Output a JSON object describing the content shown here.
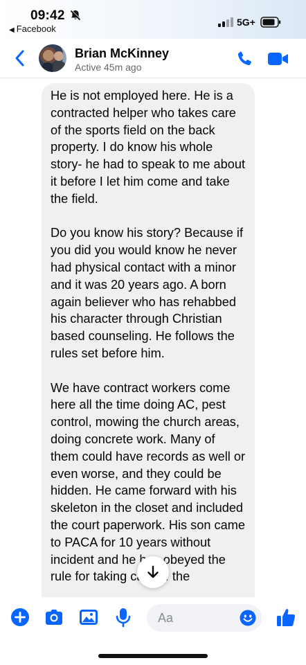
{
  "status_bar": {
    "time": "09:42",
    "back_app": "Facebook",
    "network": "5G+"
  },
  "header": {
    "contact_name": "Brian McKinney",
    "active_status": "Active 45m ago"
  },
  "message": {
    "paragraphs": [
      "He is not employed here. He is a contracted helper who takes care of the sports field on the back property. I do know his whole story- he had to speak to me about it before I let him come and take the field.",
      "Do you know his story? Because if you did you would know he never had physical contact with a minor and it was 20 years ago. A born again believer who has rehabbed his character through Christian based counseling. He follows the rules set before him.",
      "We have contract workers come here all the time doing AC, pest control, mowing the church areas, doing concrete work. Many of them could have records as well or even worse, and they could be hidden. He came forward with his skeleton in the closet and included the court paperwork. His son came to PACA for 10 years without incident and he has obeyed the rule for taking care of the"
    ]
  },
  "composer": {
    "placeholder": "Aa"
  },
  "colors": {
    "accent": "#0866ff",
    "bubble": "#f0f0f0",
    "secondary_text": "#65676b"
  },
  "icons": [
    "bell-muted-icon",
    "back-chevron-icon",
    "phone-icon",
    "video-camera-icon",
    "plus-icon",
    "camera-icon",
    "gallery-icon",
    "microphone-icon",
    "emoji-icon",
    "thumbs-up-icon",
    "arrow-down-icon"
  ]
}
